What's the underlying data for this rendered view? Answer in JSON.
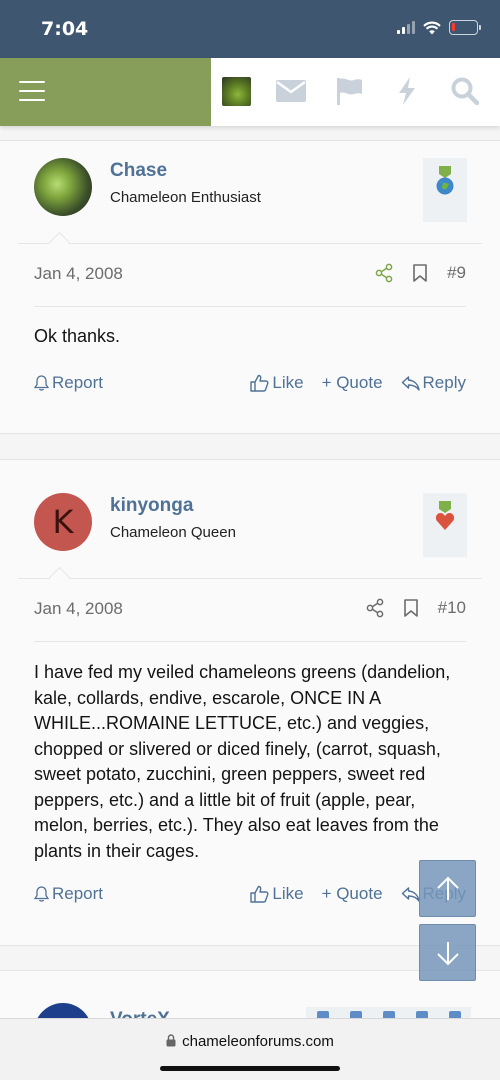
{
  "status_bar": {
    "time": "7:04",
    "icons": [
      "signal-icon",
      "wifi-icon",
      "battery-icon"
    ],
    "battery_color": "#ff3b30",
    "battery_level": 0.12
  },
  "navbar": {
    "menu_color": "#879e5b",
    "icons": [
      "menu-icon",
      "user-avatar",
      "envelope-icon",
      "flag-icon",
      "bolt-icon",
      "search-icon"
    ]
  },
  "posts": [
    {
      "username": "Chase",
      "user_title": "Chameleon Enthusiast",
      "avatar_letter": "",
      "date": "Jan 4, 2008",
      "post_number": "#9",
      "body": "Ok thanks.",
      "trophy_icon": "globe-medal-icon"
    },
    {
      "username": "kinyonga",
      "user_title": "Chameleon Queen",
      "avatar_letter": "K",
      "date": "Jan 4, 2008",
      "post_number": "#10",
      "body": "I have fed my veiled chameleons greens (dandelion, kale, collards, endive, escarole, ONCE IN A WHILE...ROMAINE LETTUCE, etc.) and veggies, chopped or slivered or diced finely, (carrot, squash, sweet potato, zucchini, green peppers, sweet red peppers, etc.) and a little bit of fruit (apple, pear, melon, berries, etc.). They also eat leaves from the plants in their cages.",
      "trophy_icon": "heart-medal-icon"
    },
    {
      "username": "VorteX"
    }
  ],
  "actions": {
    "report": "Report",
    "like": "Like",
    "quote": "+ Quote",
    "reply": "Reply"
  },
  "browser": {
    "url": "chameleonforums.com"
  },
  "colors": {
    "link": "#4f7296",
    "accent_green": "#879e5b",
    "status_bar": "#3e5670"
  }
}
